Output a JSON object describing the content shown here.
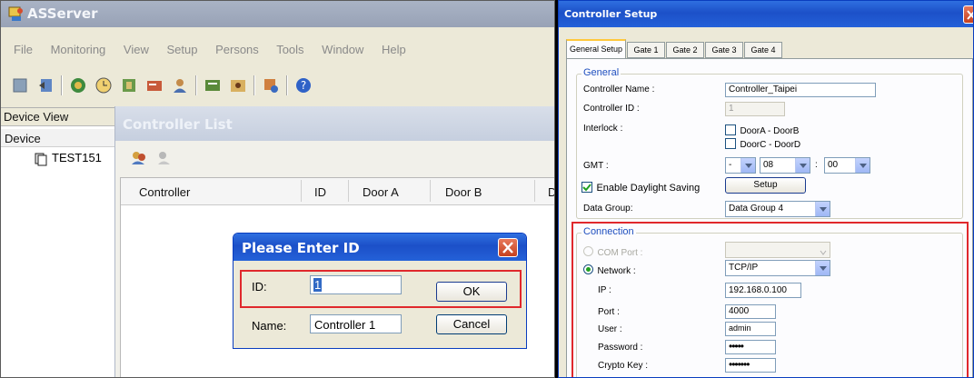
{
  "left_window": {
    "title": "ASServer",
    "menu": [
      "File",
      "Monitoring",
      "View",
      "Setup",
      "Persons",
      "Tools",
      "Window",
      "Help"
    ],
    "device_view_label": "Device View",
    "device_col_label": "Device",
    "device_item": "TEST151"
  },
  "controller_list": {
    "title": "Controller List",
    "columns": [
      "Controller",
      "ID",
      "Door A",
      "Door B",
      "D"
    ]
  },
  "id_dialog": {
    "title": "Please Enter ID",
    "id_label": "ID:",
    "id_value": "1",
    "ok_label": "OK",
    "name_label": "Name:",
    "name_value": "Controller 1",
    "cancel_label": "Cancel"
  },
  "setup_window": {
    "title": "Controller Setup",
    "tabs": [
      "General Setup",
      "Gate 1",
      "Gate 2",
      "Gate 3",
      "Gate 4"
    ],
    "general_group": "General",
    "controller_name_label": "Controller Name :",
    "controller_name_value": "Controller_Taipei",
    "controller_id_label": "Controller ID :",
    "controller_id_value": "1",
    "interlock_label": "Interlock :",
    "interlock_a": "DoorA - DoorB",
    "interlock_c": "DoorC - DoorD",
    "gmt_label": "GMT :",
    "gmt_sign": "-",
    "gmt_hour": "08",
    "gmt_colon": ":",
    "gmt_min": "00",
    "daylight_label": "Enable Daylight Saving",
    "setup_button": "Setup",
    "data_group_label": "Data Group:",
    "data_group_value": "Data Group 4",
    "connection_group": "Connection",
    "com_port_label": "COM Port :",
    "network_label": "Network :",
    "network_value": "TCP/IP",
    "ip_label": "IP :",
    "ip_value": "192.168.0.100",
    "port_label": "Port :",
    "port_value": "4000",
    "user_label": "User :",
    "user_value": "admin",
    "password_label": "Password :",
    "password_value": "•••••",
    "crypto_label": "Crypto Key :",
    "crypto_value": "•••••••",
    "highlight_color": "#e0282c"
  }
}
